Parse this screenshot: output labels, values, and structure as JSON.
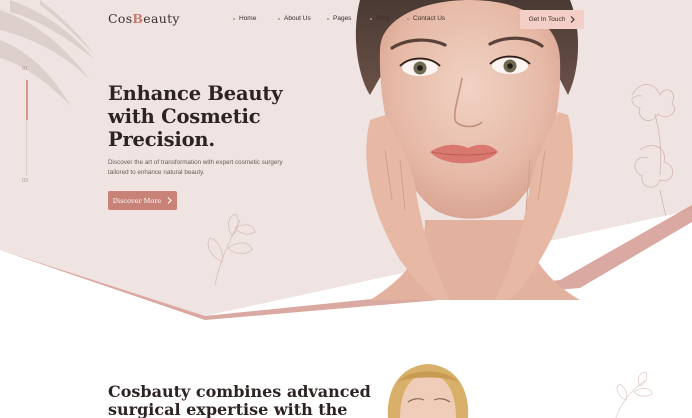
{
  "header": {
    "logo_prefix": "Cos",
    "logo_mark": "B",
    "logo_suffix": "eauty",
    "nav": [
      {
        "label": "Home"
      },
      {
        "label": "About Us"
      },
      {
        "label": "Pages"
      },
      {
        "label": "Blog"
      },
      {
        "label": "Contact Us"
      }
    ],
    "cta_label": "Get In Touch",
    "cta_icon": "chevron-right-icon"
  },
  "slider": {
    "current": "01",
    "total": "03"
  },
  "hero": {
    "title_lines": [
      "Enhance Beauty",
      "with Cosmetic",
      "Precision."
    ],
    "description": "Discover the art of transformation with expert cosmetic surgery tailored to enhance natural beauty.",
    "button_label": "Discover More",
    "button_icon": "chevron-right-icon"
  },
  "section2": {
    "title_lines": [
      "Cosbauty combines advanced",
      "surgical expertise with the"
    ]
  },
  "colors": {
    "hero_bg": "#efe4e1",
    "accent": "#c98278",
    "cta_bg": "#f3cfc7",
    "wave_accent": "#d49a91"
  }
}
